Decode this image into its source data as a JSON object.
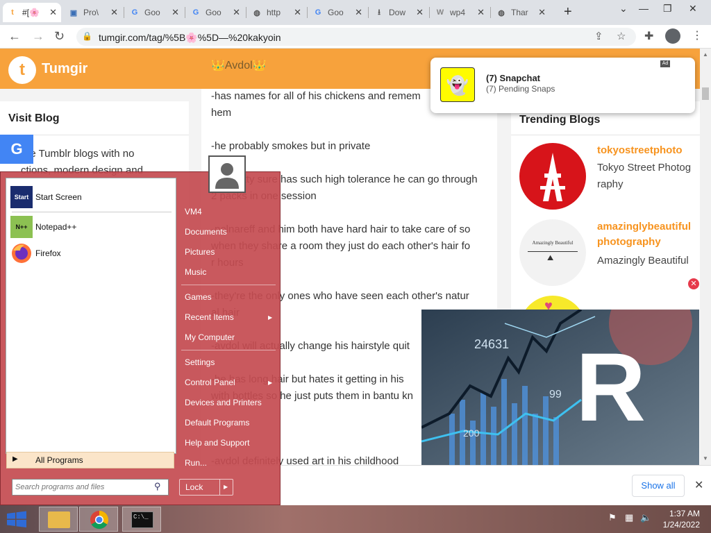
{
  "browser": {
    "tabs": [
      {
        "favicon": "t",
        "favicon_color": "#f7a23c",
        "title": "#[🌸",
        "active": true
      },
      {
        "favicon": "▣",
        "favicon_color": "#3b6fb6",
        "title": "Pro\\"
      },
      {
        "favicon": "G",
        "favicon_color": "#4285f4",
        "title": "Goo"
      },
      {
        "favicon": "G",
        "favicon_color": "#4285f4",
        "title": "Goo"
      },
      {
        "favicon": "◍",
        "favicon_color": "#555555",
        "title": "http"
      },
      {
        "favicon": "G",
        "favicon_color": "#4285f4",
        "title": "Goo"
      },
      {
        "favicon": "⭳",
        "favicon_color": "#555555",
        "title": "Dow"
      },
      {
        "favicon": "W",
        "favicon_color": "#888888",
        "title": "wp4"
      },
      {
        "favicon": "◍",
        "favicon_color": "#555555",
        "title": "Thar"
      }
    ],
    "new_tab": "+",
    "url": "tumgir.com/tag/%5B🌸%5D—%20kakyoin"
  },
  "site": {
    "brand": "Tumgir",
    "logo_letter": "t",
    "brand_color": "#f7a23c",
    "post_name": "👑Avdol👑",
    "left_title": "Visit Blog",
    "left_text_1": "ore Tumblr blogs with no",
    "left_text_2": "ctions, modern design and",
    "google_letter": "G",
    "post_lines": [
      "-has names for all of his chickens and remem",
      "hem",
      "-he probably smokes but in private",
      "-im pretty sure has such high tolerance he can go through",
      "2 packs in one session",
      "-polnareff and him both have hard hair to take care of so",
      "when they share a room they just do each other's hair fo",
      "r hours",
      "-they're the only ones who have seen each other's natur",
      "al hair",
      "-avdol will actually change his hairstyle quit",
      "-he has long hair but hates it getting in his",
      "with bottles so he just puts them in bantu kn",
      "-avdol definitely used art in his childhood"
    ],
    "right_title": "Trending Blogs",
    "blogs": [
      {
        "name": "tokyostreetphoto",
        "desc": "Tokyo Street Photography"
      },
      {
        "name": "amazinglybeautifulphotography",
        "desc": "Amazingly Beautiful",
        "avatar_text": "Amazingly Beautiful"
      }
    ]
  },
  "popup": {
    "title": "(7) Snapchat",
    "subtitle": "(7) Pending Snaps",
    "ad": "Ad"
  },
  "video_ad": {
    "big_letter": "R",
    "numbers": [
      "24631",
      "99",
      "200"
    ]
  },
  "downloads": {
    "show_all": "Show all"
  },
  "start_menu": {
    "pinned": [
      {
        "label": "Start Screen",
        "icon": "Start"
      },
      {
        "label": "Notepad++",
        "icon": "N++"
      },
      {
        "label": "Firefox",
        "icon": ""
      }
    ],
    "all_programs": "All Programs",
    "search_placeholder": "Search programs and files",
    "right_groups": [
      [
        "VM4",
        "Documents",
        "Pictures",
        "Music"
      ],
      [
        "Games",
        "Recent Items",
        "My Computer"
      ],
      [
        "Settings",
        "Control Panel",
        "Devices and Printers",
        "Default Programs",
        "Help and Support",
        "Run..."
      ]
    ],
    "lock": "Lock"
  },
  "taskbar": {
    "time": "1:37 AM",
    "date": "1/24/2022"
  }
}
